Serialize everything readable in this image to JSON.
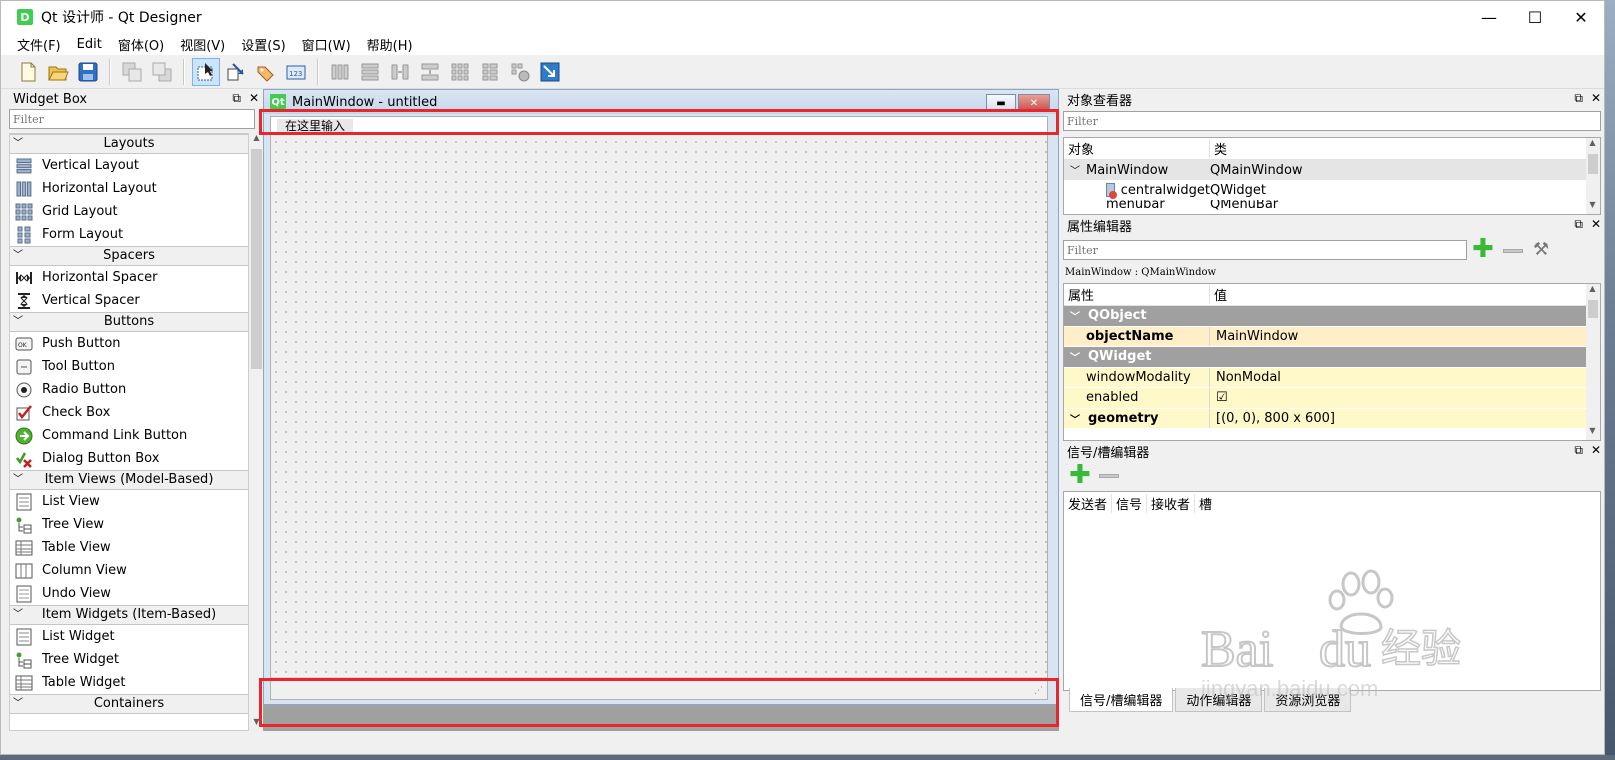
{
  "window": {
    "title": "Qt 设计师 - Qt Designer",
    "logo": "D"
  },
  "menu": [
    "文件(F)",
    "Edit",
    "窗体(O)",
    "视图(V)",
    "设置(S)",
    "窗口(W)",
    "帮助(H)"
  ],
  "widget_box": {
    "title": "Widget Box",
    "filter_placeholder": "Filter",
    "categories": [
      {
        "label": "Layouts",
        "items": [
          {
            "label": "Vertical Layout",
            "icon": "vertical-layout-icon"
          },
          {
            "label": "Horizontal Layout",
            "icon": "horizontal-layout-icon"
          },
          {
            "label": "Grid Layout",
            "icon": "grid-layout-icon"
          },
          {
            "label": "Form Layout",
            "icon": "form-layout-icon"
          }
        ]
      },
      {
        "label": "Spacers",
        "items": [
          {
            "label": "Horizontal Spacer",
            "icon": "horizontal-spacer-icon"
          },
          {
            "label": "Vertical Spacer",
            "icon": "vertical-spacer-icon"
          }
        ]
      },
      {
        "label": "Buttons",
        "items": [
          {
            "label": "Push Button",
            "icon": "push-button-icon"
          },
          {
            "label": "Tool Button",
            "icon": "tool-button-icon"
          },
          {
            "label": "Radio Button",
            "icon": "radio-button-icon"
          },
          {
            "label": "Check Box",
            "icon": "check-box-icon"
          },
          {
            "label": "Command Link Button",
            "icon": "command-link-icon"
          },
          {
            "label": "Dialog Button Box",
            "icon": "dialog-button-box-icon"
          }
        ]
      },
      {
        "label": "Item Views (Model-Based)",
        "items": [
          {
            "label": "List View",
            "icon": "list-view-icon"
          },
          {
            "label": "Tree View",
            "icon": "tree-view-icon"
          },
          {
            "label": "Table View",
            "icon": "table-view-icon"
          },
          {
            "label": "Column View",
            "icon": "column-view-icon"
          },
          {
            "label": "Undo View",
            "icon": "undo-view-icon"
          }
        ]
      },
      {
        "label": "Item Widgets (Item-Based)",
        "items": [
          {
            "label": "List Widget",
            "icon": "list-widget-icon"
          },
          {
            "label": "Tree Widget",
            "icon": "tree-widget-icon"
          },
          {
            "label": "Table Widget",
            "icon": "table-widget-icon"
          }
        ]
      },
      {
        "label": "Containers",
        "items": []
      }
    ]
  },
  "mdi": {
    "subwindow_title": "MainWindow - untitled",
    "logo": "Qt",
    "menu_placeholder": "在这里输入"
  },
  "object_inspector": {
    "title": "对象查看器",
    "filter_placeholder": "Filter",
    "col_object": "对象",
    "col_class": "类",
    "rows": [
      {
        "name": "MainWindow",
        "class": "QMainWindow"
      },
      {
        "name": "centralwidget",
        "class": "QWidget"
      },
      {
        "name": "menubar",
        "class": "QMenuBar"
      }
    ]
  },
  "property_editor": {
    "title": "属性编辑器",
    "filter_placeholder": "Filter",
    "context": "MainWindow : QMainWindow",
    "col_property": "属性",
    "col_value": "值",
    "rows": [
      {
        "group": "QObject"
      },
      {
        "name": "objectName",
        "value": "MainWindow"
      },
      {
        "group": "QWidget"
      },
      {
        "name": "windowModality",
        "value": "NonModal"
      },
      {
        "name": "enabled",
        "value": "☑"
      },
      {
        "name": "geometry",
        "value": "[(0, 0), 800 x 600]"
      }
    ]
  },
  "signal_slot_editor": {
    "title": "信号/槽编辑器",
    "cols": [
      "发送者",
      "信号",
      "接收者",
      "槽"
    ]
  },
  "bottom_tabs": [
    "信号/槽编辑器",
    "动作编辑器",
    "资源浏览器"
  ],
  "watermark": {
    "brand_left": "Bai",
    "brand_right": "du",
    "brand_cn": "经验",
    "url": "jingyan.baidu.com"
  },
  "colors": {
    "highlight": "#e8262b",
    "qt_green": "#41cd52"
  }
}
